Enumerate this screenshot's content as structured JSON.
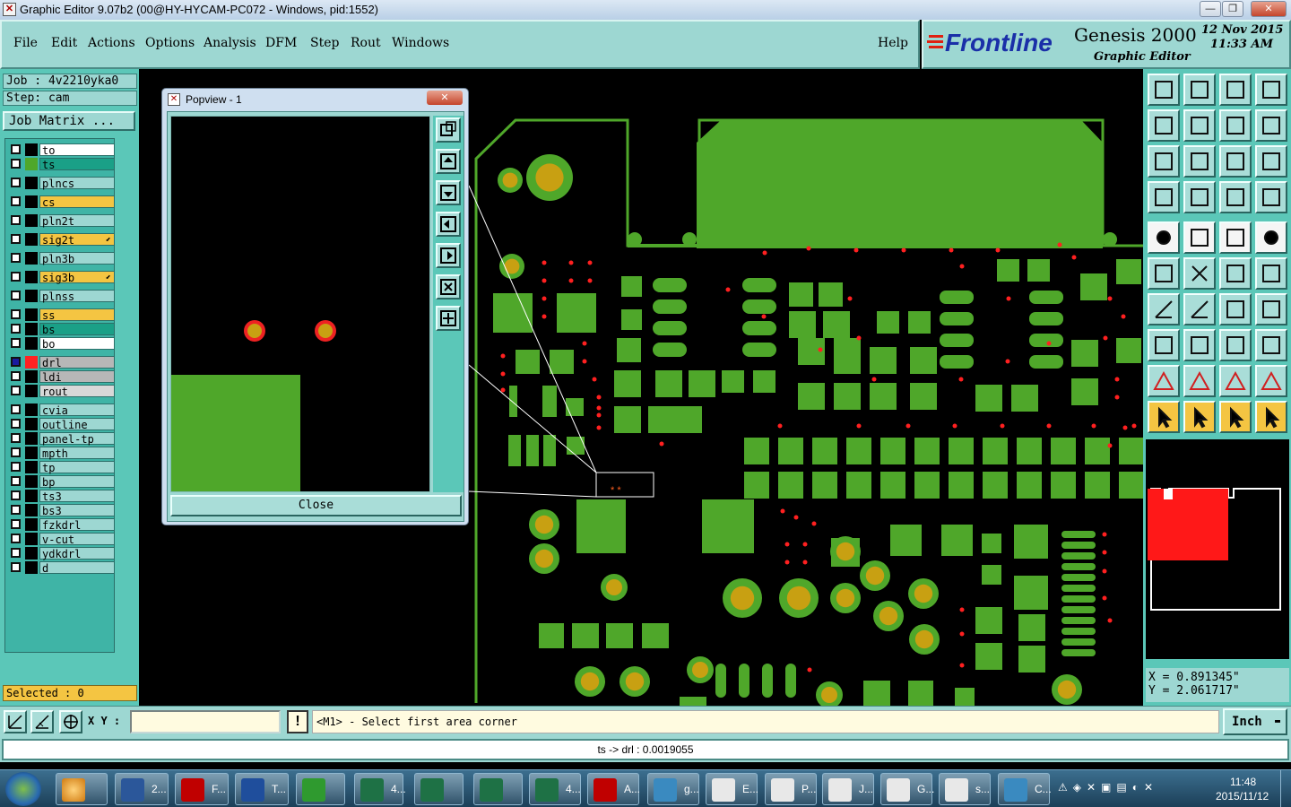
{
  "window": {
    "title": "Graphic Editor 9.07b2 (00@HY-HYCAM-PC072 - Windows, pid:1552)",
    "min": "—",
    "max": "❐",
    "close": "✕"
  },
  "menu": {
    "items": [
      "File",
      "Edit",
      "Actions",
      "Options",
      "Analysis",
      "DFM",
      "Step",
      "Rout",
      "Windows"
    ],
    "help": "Help"
  },
  "brand": {
    "logo": "Frontline",
    "product": "Genesis 2000",
    "subtitle": "Graphic Editor",
    "date": "12 Nov 2015",
    "time": "11:33 AM"
  },
  "job": {
    "job_label": "Job : 4v2210yka0",
    "step_label": "Step: cam",
    "matrix_button": "Job Matrix ..."
  },
  "layers": [
    {
      "name": "to",
      "color": "#ffffff",
      "swatch": "#000000"
    },
    {
      "name": "ts",
      "color": "#1aa087",
      "swatch": "#4fa72a"
    },
    {
      "name": "plncs",
      "color": "#9dd7d2",
      "swatch": "#000000"
    },
    {
      "name": "cs",
      "color": "#f4c542",
      "swatch": "#000000"
    },
    {
      "name": "pln2t",
      "color": "#9dd7d2",
      "swatch": "#000000"
    },
    {
      "name": "sig2t",
      "color": "#f4c542",
      "swatch": "#000000",
      "arrow": true
    },
    {
      "name": "pln3b",
      "color": "#9dd7d2",
      "swatch": "#000000"
    },
    {
      "name": "sig3b",
      "color": "#f4c542",
      "swatch": "#000000",
      "arrow": true
    },
    {
      "name": "plnss",
      "color": "#9dd7d2",
      "swatch": "#000000"
    },
    {
      "name": "ss",
      "color": "#f4c542",
      "swatch": "#000000"
    },
    {
      "name": "bs",
      "color": "#1aa087",
      "swatch": "#000000"
    },
    {
      "name": "bo",
      "color": "#ffffff",
      "swatch": "#000000"
    },
    {
      "name": "drl",
      "color": "#b7b7b7",
      "swatch": "#ff2222",
      "active": true
    },
    {
      "name": "ldi",
      "color": "#b7b7b7",
      "swatch": "#000000"
    },
    {
      "name": "rout",
      "color": "#d8d8d8",
      "swatch": "#000000"
    },
    {
      "name": "cvia",
      "color": "#9dd7d2",
      "swatch": "#000000"
    },
    {
      "name": "outline",
      "color": "#9dd7d2",
      "swatch": "#000000"
    },
    {
      "name": "panel-tp",
      "color": "#9dd7d2",
      "swatch": "#000000"
    },
    {
      "name": "mpth",
      "color": "#9dd7d2",
      "swatch": "#000000"
    },
    {
      "name": "tp",
      "color": "#9dd7d2",
      "swatch": "#000000"
    },
    {
      "name": "bp",
      "color": "#9dd7d2",
      "swatch": "#000000"
    },
    {
      "name": "ts3",
      "color": "#9dd7d2",
      "swatch": "#000000"
    },
    {
      "name": "bs3",
      "color": "#9dd7d2",
      "swatch": "#000000"
    },
    {
      "name": "fzkdrl",
      "color": "#9dd7d2",
      "swatch": "#000000"
    },
    {
      "name": "v-cut",
      "color": "#9dd7d2",
      "swatch": "#000000"
    },
    {
      "name": "ydkdrl",
      "color": "#9dd7d2",
      "swatch": "#000000"
    },
    {
      "name": "d",
      "color": "#9dd7d2",
      "swatch": "#000000"
    }
  ],
  "selected": "Selected : 0",
  "popview": {
    "title": "Popview - 1",
    "close_label": "Close"
  },
  "coords": {
    "x": "X = 0.891345\"",
    "y": "Y = 2.061717\""
  },
  "bottom": {
    "xy_label": "X Y :",
    "xy_value": "",
    "bang": "!",
    "prompt": "<M1> - Select first area corner",
    "units": "Inch"
  },
  "status": "ts -> drl : 0.0019055",
  "taskbar": {
    "apps": [
      {
        "label": "2...",
        "color": "#2b579a"
      },
      {
        "label": "F...",
        "color": "#c00000"
      },
      {
        "label": "T...",
        "color": "#1f4e9c"
      },
      {
        "label": "",
        "color": "#2f9a2f"
      },
      {
        "label": "4...",
        "color": "#1e7145"
      },
      {
        "label": "",
        "color": "#1e7145"
      },
      {
        "label": "",
        "color": "#1e7145"
      },
      {
        "label": "4...",
        "color": "#1e7145"
      },
      {
        "label": "A...",
        "color": "#c00000"
      },
      {
        "label": "g...",
        "color": "#3a8ac0"
      },
      {
        "label": "E...",
        "color": "#e8e8e8"
      },
      {
        "label": "P...",
        "color": "#e8e8e8"
      },
      {
        "label": "J...",
        "color": "#e8e8e8"
      },
      {
        "label": "G...",
        "color": "#e8e8e8"
      },
      {
        "label": "s...",
        "color": "#e8e8e8"
      },
      {
        "label": "C...",
        "color": "#3a8ac0"
      }
    ],
    "time": "11:48",
    "date": "2015/11/12"
  },
  "colors": {
    "copper": "#4fa72a",
    "drill": "#ff2020",
    "hole": "#c8a012",
    "panel": "#9dd7d2",
    "accent": "#f4c542"
  }
}
